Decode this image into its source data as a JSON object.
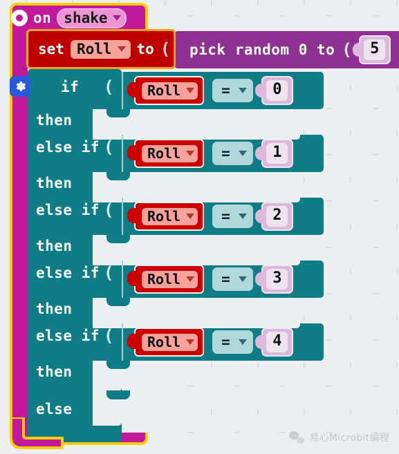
{
  "workspace": {
    "background_color": "#eceff1",
    "grid_color": "#d4dadd"
  },
  "event_block": {
    "icon": "shake-target-icon",
    "keyword": "on",
    "event_name": "shake",
    "dropdown_caret": "caret-down-icon",
    "color": "#c2199b",
    "selection_border": "#ffcc00"
  },
  "set_block": {
    "keyword": "set",
    "variable": "Roll",
    "dropdown_caret": "caret-down-icon",
    "to_word": "to",
    "open_paren": "(",
    "color": "#be0000",
    "selection_border": "#f0a31e"
  },
  "pick_random_block": {
    "text": "pick random 0 to",
    "open_paren": "(",
    "max_value": "5",
    "color": "#8e3192"
  },
  "if_block": {
    "gear_icon": "gear-icon",
    "color": "#0f7c86",
    "if_label": "if",
    "then_label": "then",
    "else_if_label": "else if",
    "else_label": "else",
    "open_paren": "(",
    "branches": [
      {
        "keyword": "if",
        "variable": "Roll",
        "operator": "=",
        "value": "0",
        "then_label": "then"
      },
      {
        "keyword": "else if",
        "variable": "Roll",
        "operator": "=",
        "value": "1",
        "then_label": "then"
      },
      {
        "keyword": "else if",
        "variable": "Roll",
        "operator": "=",
        "value": "2",
        "then_label": "then"
      },
      {
        "keyword": "else if",
        "variable": "Roll",
        "operator": "=",
        "value": "3",
        "then_label": "then"
      },
      {
        "keyword": "else if",
        "variable": "Roll",
        "operator": "=",
        "value": "4",
        "then_label": "then"
      }
    ],
    "final_else": "else"
  },
  "watermark": {
    "icon": "wechat-icon",
    "text": "易心Microbit编程"
  }
}
